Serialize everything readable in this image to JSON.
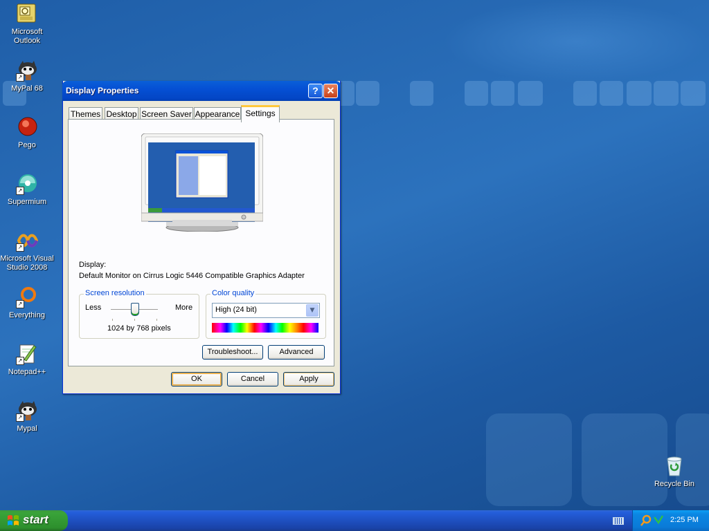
{
  "desktop": {
    "icons": [
      {
        "label": "Microsoft Outlook",
        "icon": "outlook-icon"
      },
      {
        "label": "MyPal 68",
        "icon": "mypal-icon"
      },
      {
        "label": "Pego",
        "icon": "pego-icon"
      },
      {
        "label": "Supermium",
        "icon": "supermium-icon"
      },
      {
        "label": "Microsoft Visual Studio 2008",
        "icon": "visual-studio-icon"
      },
      {
        "label": "Everything",
        "icon": "everything-icon"
      },
      {
        "label": "Notepad++",
        "icon": "notepadpp-icon"
      },
      {
        "label": "Mypal",
        "icon": "mypal-icon"
      },
      {
        "label": "Recycle Bin",
        "icon": "recycle-bin-icon"
      }
    ]
  },
  "dialog": {
    "title": "Display Properties",
    "help_glyph": "?",
    "close_glyph": "✕",
    "tabs": [
      "Themes",
      "Desktop",
      "Screen Saver",
      "Appearance",
      "Settings"
    ],
    "active_tab": "Settings",
    "display_label": "Display:",
    "display_value": "Default Monitor on Cirrus Logic 5446 Compatible Graphics Adapter",
    "resolution": {
      "group_label": "Screen resolution",
      "less": "Less",
      "more": "More",
      "value": "1024 by 768 pixels",
      "slider_position": 0.5
    },
    "color": {
      "group_label": "Color quality",
      "selected": "High (24 bit)"
    },
    "buttons": {
      "troubleshoot": "Troubleshoot...",
      "advanced": "Advanced",
      "ok": "OK",
      "cancel": "Cancel",
      "apply": "Apply"
    }
  },
  "taskbar": {
    "start_label": "start",
    "clock": "2:25 PM"
  },
  "colors": {
    "desktop": "#2a6cb8",
    "titlebar": "#0550d4",
    "start": "#39a339"
  }
}
